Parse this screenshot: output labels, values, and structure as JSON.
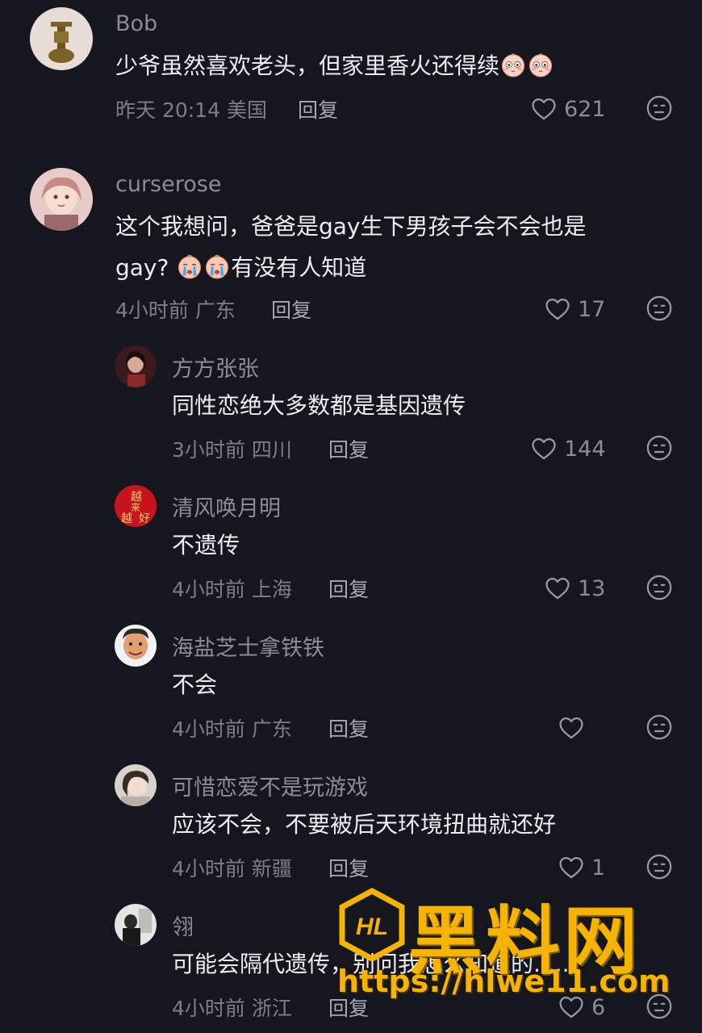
{
  "comments": [
    {
      "user": "Bob",
      "text": "少爷虽然喜欢老头，但家里香火还得续",
      "meta": "昨天 20:14 美国",
      "reply": "回复",
      "likes": "621"
    },
    {
      "user": "curserose",
      "text1": "这个我想问，爸爸是gay生下男孩子会不会也是",
      "text2": "gay?",
      "text3": "有没有人知道",
      "meta": "4小时前 广东",
      "reply": "回复",
      "likes": "17"
    },
    {
      "user": "方方张张",
      "text": "同性恋绝大多数都是基因遗传",
      "meta": "3小时前 四川",
      "reply": "回复",
      "likes": "144"
    },
    {
      "user": "清风唤月明",
      "text": "不遗传",
      "meta": "4小时前 上海",
      "reply": "回复",
      "likes": "13"
    },
    {
      "user": "海盐芝士拿铁铁",
      "text": "不会",
      "meta": "4小时前 广东",
      "reply": "回复",
      "likes": ""
    },
    {
      "user": "可惜恋爱不是玩游戏",
      "text": "应该不会，不要被后天环境扭曲就还好",
      "meta": "4小时前 新疆",
      "reply": "回复",
      "likes": "1"
    },
    {
      "user": "翎",
      "text": "可能会隔代遗传，别问我怎么知道的......",
      "meta": "4小时前 浙江",
      "reply": "回复",
      "likes": "6"
    }
  ],
  "avatar_seals": {
    "chars": "越来越好"
  },
  "watermark": {
    "logo_text": "HL",
    "title": "黑料网",
    "url": "https://hlwe11.com"
  },
  "colors": {
    "background": "#16161e",
    "username": "#8d8c95",
    "text": "#ececf1",
    "meta": "#7f7e87",
    "watermark": "#f6b400"
  }
}
